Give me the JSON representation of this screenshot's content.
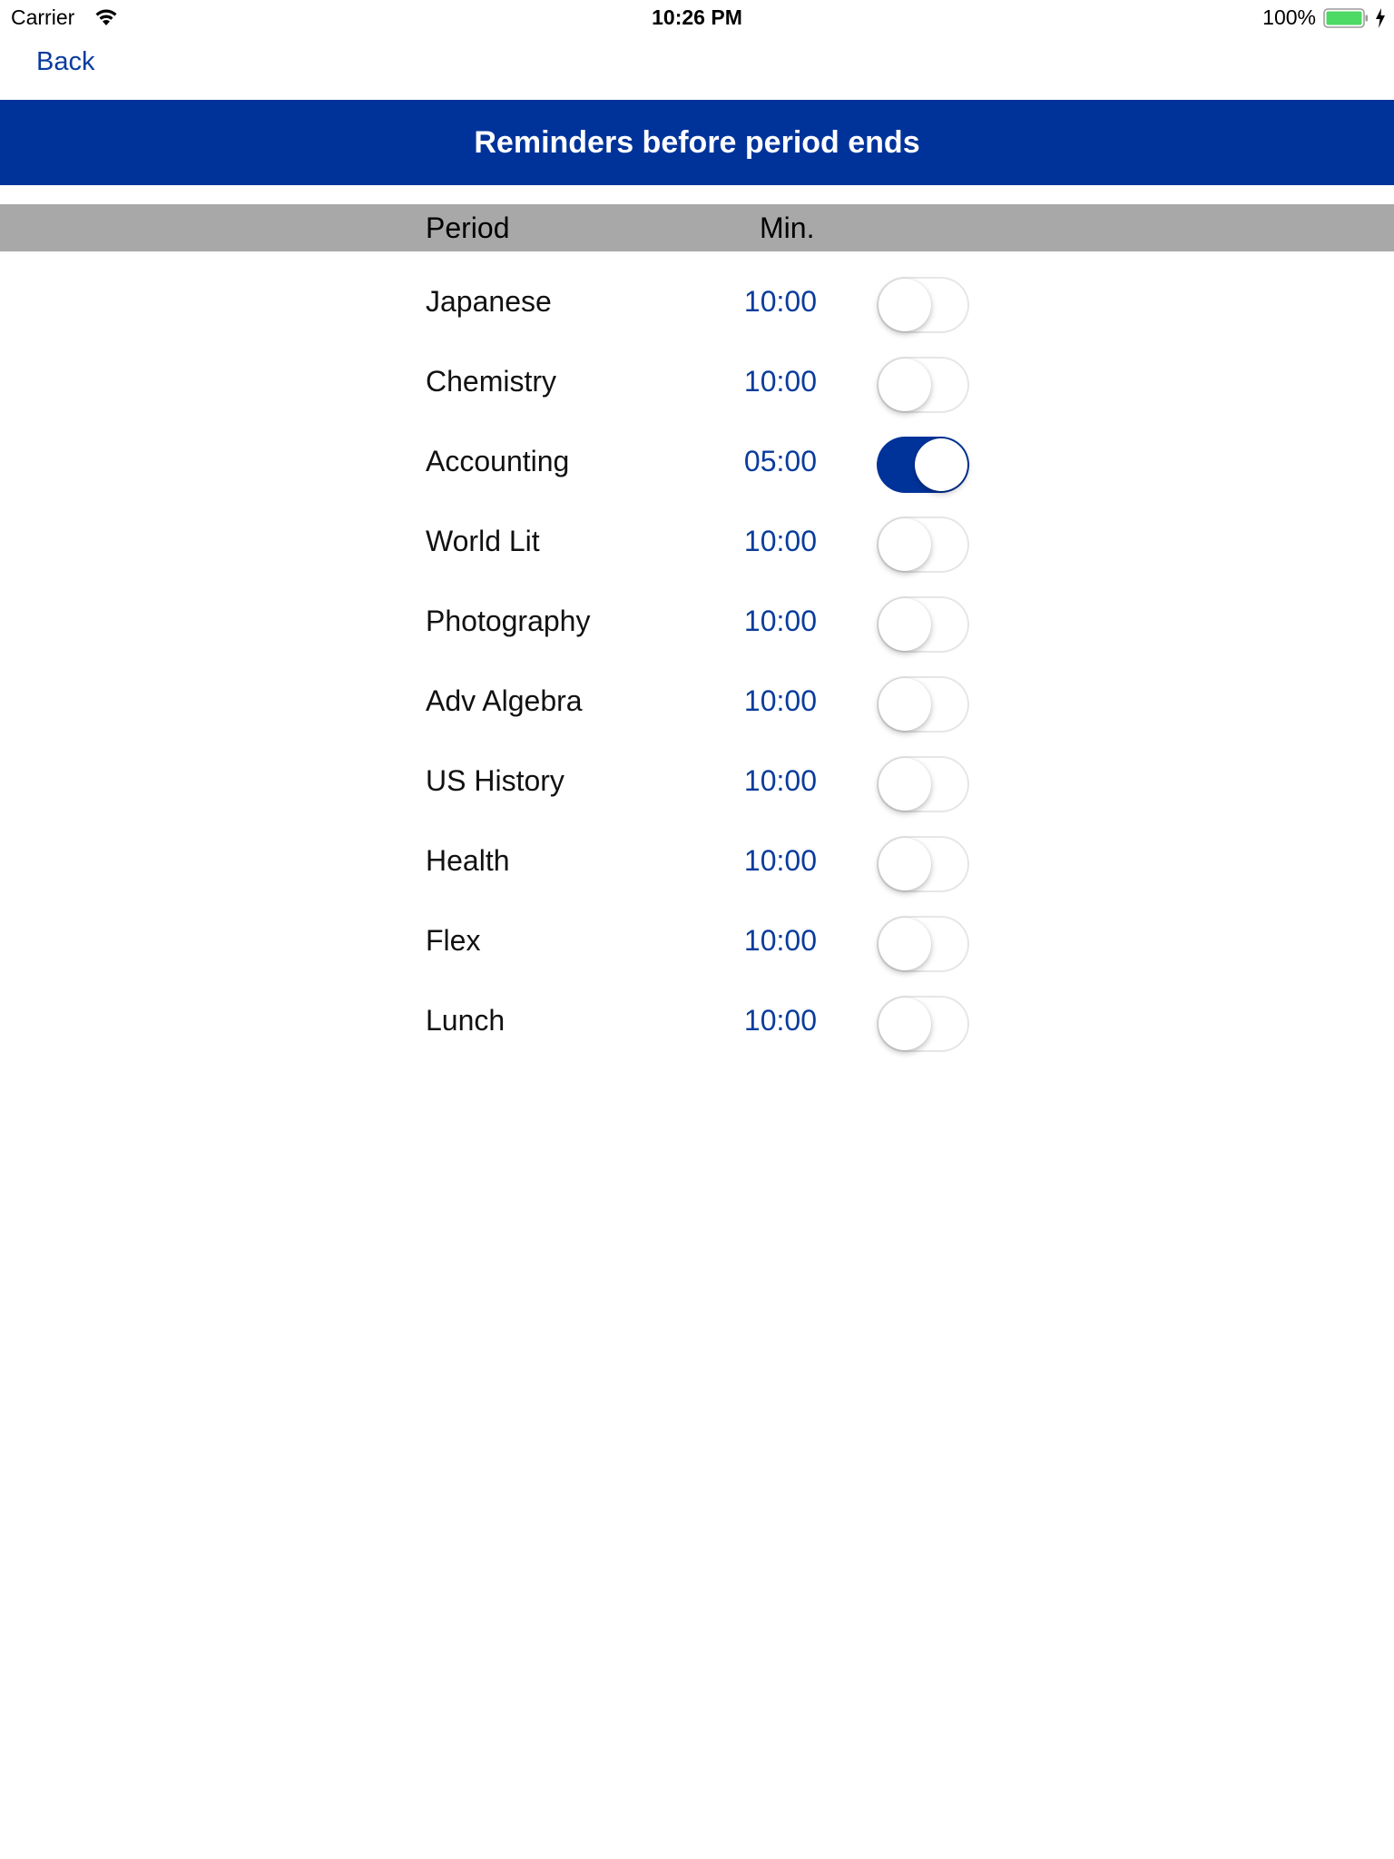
{
  "status_bar": {
    "carrier": "Carrier",
    "time": "10:26 PM",
    "battery_percent": "100%",
    "battery_level": 1.0,
    "battery_color": "#4CD964"
  },
  "nav": {
    "back_label": "Back"
  },
  "title": "Reminders before period ends",
  "header": {
    "period": "Period",
    "min": "Min."
  },
  "colors": {
    "accent": "#00339A",
    "link": "#0A3C9C",
    "header_bg": "#A8A8A8"
  },
  "periods": [
    {
      "name": "Japanese",
      "minutes": "10:00",
      "enabled": false
    },
    {
      "name": "Chemistry",
      "minutes": "10:00",
      "enabled": false
    },
    {
      "name": "Accounting",
      "minutes": "05:00",
      "enabled": true
    },
    {
      "name": "World Lit",
      "minutes": "10:00",
      "enabled": false
    },
    {
      "name": "Photography",
      "minutes": "10:00",
      "enabled": false
    },
    {
      "name": "Adv Algebra",
      "minutes": "10:00",
      "enabled": false
    },
    {
      "name": "US History",
      "minutes": "10:00",
      "enabled": false
    },
    {
      "name": "Health",
      "minutes": "10:00",
      "enabled": false
    },
    {
      "name": "Flex",
      "minutes": "10:00",
      "enabled": false
    },
    {
      "name": "Lunch",
      "minutes": "10:00",
      "enabled": false
    }
  ]
}
